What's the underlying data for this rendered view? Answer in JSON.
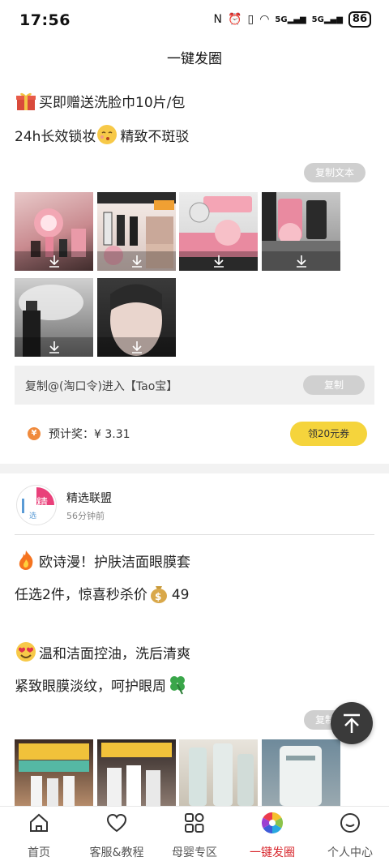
{
  "status": {
    "time": "17:56",
    "network": "5G",
    "network2": "5G",
    "battery": "86"
  },
  "page_title": "一键发圈",
  "post1": {
    "line1": "买即赠送洗脸巾10片/包",
    "line2a": "24h长效锁妆",
    "line2b": "精致不斑驳",
    "copy_text_label": "复制文本",
    "tao_text": "复制@(淘口令)进入【Tao宝】",
    "tao_copy_label": "复制",
    "reward_label": "预计奖：",
    "reward_value": "¥ 3.31",
    "coin_symbol": "¥",
    "coupon_label": "领20元券"
  },
  "post2": {
    "author": "精选联盟",
    "time": "56分钟前",
    "avatar_text": "精",
    "avatar_sub": "选",
    "line1": "欧诗漫！护肤洁面眼膜套",
    "line2a": "任选2件，惊喜秒杀价",
    "line2b": "49",
    "line3": "温和洁面控油，洗后清爽",
    "line4": "紧致眼膜淡纹，呵护眼周",
    "copy_text_label": "复制"
  },
  "nav": {
    "items": [
      {
        "label": "首页",
        "icon": "home-icon"
      },
      {
        "label": "客服&教程",
        "icon": "heart-icon"
      },
      {
        "label": "母婴专区",
        "icon": "grid-icon"
      },
      {
        "label": "一键发圈",
        "icon": "shutter-icon"
      },
      {
        "label": "个人中心",
        "icon": "smile-icon"
      }
    ],
    "active_index": 3
  },
  "colors": {
    "accent": "#d8282e",
    "coupon": "#f5d43c",
    "coin": "#f08a3c"
  }
}
